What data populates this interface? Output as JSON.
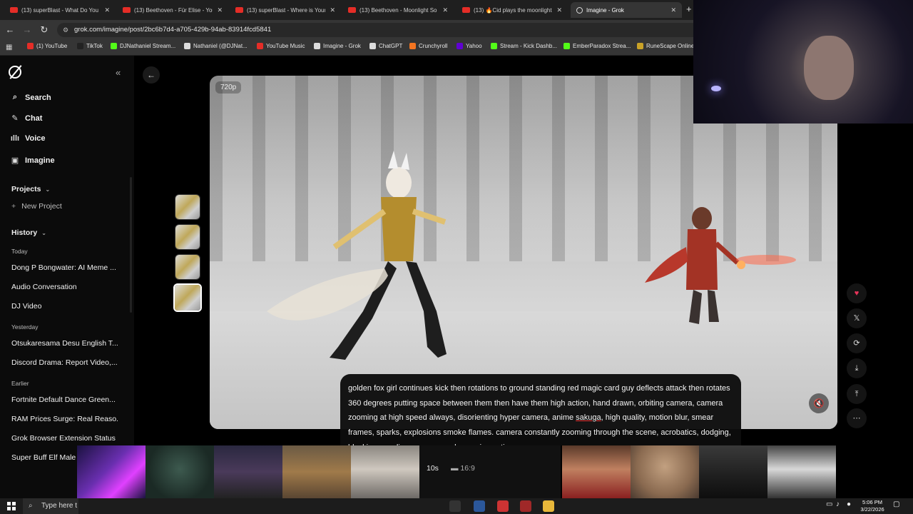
{
  "browser": {
    "tabs": [
      {
        "label": "(13) superBlast - What Do You",
        "kind": "youtube"
      },
      {
        "label": "(13) Beethoven - Für Elise - You",
        "kind": "youtube"
      },
      {
        "label": "(13) superBlast - Where is Your",
        "kind": "youtube"
      },
      {
        "label": "(13) Beethoven - Moonlight So",
        "kind": "youtube"
      },
      {
        "label": "(13) 🔥Cid plays the moonlight",
        "kind": "youtube"
      },
      {
        "label": "Imagine - Grok",
        "kind": "grok",
        "active": true
      }
    ],
    "url": "grok.com/imagine/post/2bc6b7d4-a705-429b-94ab-83914fcd5841",
    "bookmarks": [
      {
        "label": "(1) YouTube",
        "color": "#e52d27"
      },
      {
        "label": "TikTok",
        "color": "#222222"
      },
      {
        "label": "DJNathaniel Stream...",
        "color": "#53fc18"
      },
      {
        "label": "Nathaniel (@DJNat...",
        "color": "#dddddd"
      },
      {
        "label": "YouTube Music",
        "color": "#e52d27"
      },
      {
        "label": "Imagine - Grok",
        "color": "#dddddd"
      },
      {
        "label": "ChatGPT",
        "color": "#dddddd"
      },
      {
        "label": "Crunchyroll",
        "color": "#f47521"
      },
      {
        "label": "Yahoo",
        "color": "#6001d2"
      },
      {
        "label": "Stream - Kick Dashb...",
        "color": "#53fc18"
      },
      {
        "label": "EmberParadox Strea...",
        "color": "#53fc18"
      },
      {
        "label": "RuneScape Online",
        "color": "#c9a227"
      }
    ]
  },
  "sidebar": {
    "nav": [
      {
        "label": "Search",
        "icon": "search-icon"
      },
      {
        "label": "Chat",
        "icon": "chat-icon"
      },
      {
        "label": "Voice",
        "icon": "voice-icon"
      },
      {
        "label": "Imagine",
        "icon": "imagine-icon"
      }
    ],
    "projects_label": "Projects",
    "new_project_label": "New Project",
    "history_label": "History",
    "groups": {
      "today": "Today",
      "yesterday": "Yesterday",
      "earlier": "Earlier"
    },
    "history_today": [
      "Dong P Bongwater: AI Meme ...",
      "Audio Conversation",
      "DJ Video"
    ],
    "history_yesterday": [
      "Otsukaresama Desu English T...",
      "Discord Drama: Report Video,..."
    ],
    "history_earlier": [
      "Fortnite Default Dance Green...",
      "RAM Prices Surge: Real Reaso...",
      "Grok Browser Extension Status",
      "Super Buff Elf Male"
    ]
  },
  "video": {
    "quality_badge": "720p",
    "prompt_before": "golden fox girl continues kick then rotations to ground standing red magic card guy deflects attack then rotates 360 degrees putting space between them then have them high action, hand drawn, orbiting camera, camera zooming at high speed always, disorienting hyper camera, anime ",
    "prompt_underlined": "sakuga",
    "prompt_after": ", high quality, motion blur, smear frames, sparks, explosions smoke flames. camera constantly zooming through the scene, acrobatics, dodging, blocking, evading, super speed, amazing action"
  },
  "options": {
    "duration": "10s",
    "aspect": "16:9"
  },
  "taskbar": {
    "search_placeholder": "Type here t",
    "time": "5:06 PM",
    "date": "3/22/2026"
  },
  "colors": {
    "accent_heart": "#e8345a",
    "youtube_red": "#e52d27",
    "kick_green": "#53fc18"
  }
}
